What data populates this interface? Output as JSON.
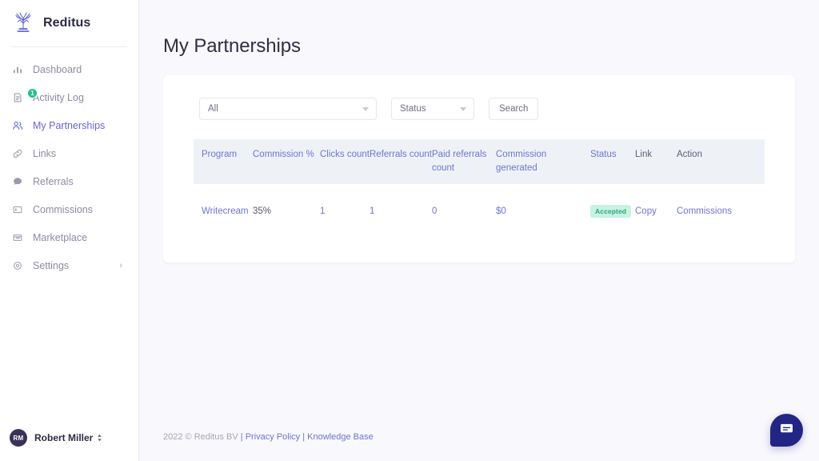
{
  "brand": {
    "name": "Reditus",
    "logo_icon": "tree-logo-icon"
  },
  "sidebar": {
    "items": [
      {
        "label": "Dashboard",
        "icon": "bar-chart-icon",
        "active": false,
        "badge": null
      },
      {
        "label": "Activity Log",
        "icon": "document-icon",
        "active": false,
        "badge": "1"
      },
      {
        "label": "My Partnerships",
        "icon": "users-icon",
        "active": true,
        "badge": null
      },
      {
        "label": "Links",
        "icon": "link-icon",
        "active": false,
        "badge": null
      },
      {
        "label": "Referrals",
        "icon": "chat-bubble-icon",
        "active": false,
        "badge": null
      },
      {
        "label": "Commissions",
        "icon": "card-icon",
        "active": false,
        "badge": null
      },
      {
        "label": "Marketplace",
        "icon": "store-icon",
        "active": false,
        "badge": null
      },
      {
        "label": "Settings",
        "icon": "gear-icon",
        "active": false,
        "badge": null,
        "chevron": "›"
      }
    ],
    "user": {
      "initials": "RM",
      "name": "Robert Miller",
      "caret_icon": "updown-caret-icon"
    }
  },
  "page": {
    "title": "My Partnerships"
  },
  "filters": {
    "program_select": {
      "value": "All",
      "caret_icon": "chevron-down-icon"
    },
    "status_select": {
      "value": "Status",
      "caret_icon": "chevron-down-icon"
    },
    "search_button": "Search"
  },
  "table": {
    "headers": [
      {
        "label": "Program",
        "accent": true
      },
      {
        "label": "Commission %",
        "accent": true
      },
      {
        "label": "Clicks count",
        "accent": true
      },
      {
        "label": "Referrals count",
        "accent": true
      },
      {
        "label": "Paid referrals count",
        "accent": true
      },
      {
        "label": "Commission generated",
        "accent": true
      },
      {
        "label": "Status",
        "accent": true
      },
      {
        "label": "Link",
        "accent": false
      },
      {
        "label": "Action",
        "accent": false
      }
    ],
    "rows": [
      {
        "program": "Writecream",
        "commission_pct": "35%",
        "clicks_count": "1",
        "referrals_count": "1",
        "paid_referrals_count": "0",
        "commission_generated": "$0",
        "status": "Accepted",
        "link": "Copy",
        "action": "Commissions"
      }
    ]
  },
  "footer": {
    "copyright": "2022 © Reditus BV",
    "sep1": "|",
    "privacy_policy": "Privacy Policy",
    "sep2": "|",
    "knowledge_base": "Knowledge Base"
  },
  "chat": {
    "icon": "chat-widget-icon"
  },
  "colors": {
    "accent": "#6f74d0",
    "page_bg": "#f8f8fd",
    "table_header_bg": "#eef2f7",
    "badge_bg": "#c7f2e2",
    "badge_text": "#2fa27d",
    "chat_bg": "#232585",
    "notification_bg": "#1fc08a",
    "avatar_bg": "#3b3355"
  }
}
